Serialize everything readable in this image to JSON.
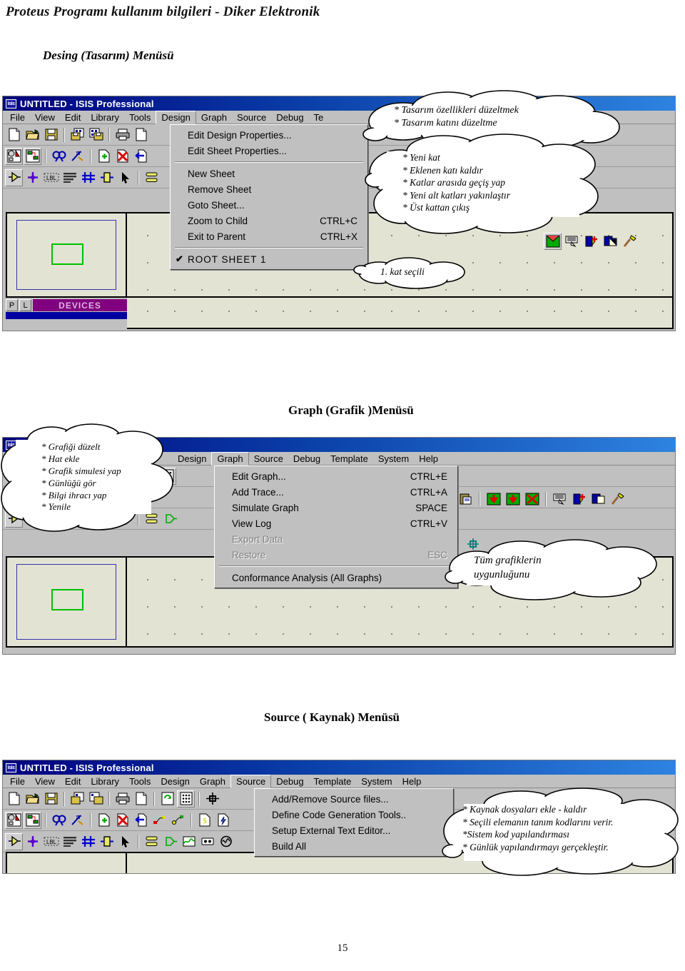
{
  "document": {
    "header": "Proteus Programı kullanım bilgileri  -  Diker  Elektronik",
    "page_number": "15"
  },
  "sections": [
    {
      "id": "design",
      "title": "Desing (Tasarım) Menüsü"
    },
    {
      "id": "graph",
      "title": "Graph (Grafik )Menüsü"
    },
    {
      "id": "source",
      "title": "Source ( Kaynak) Menüsü"
    }
  ],
  "window": {
    "title": "UNTITLED - ISIS Professional",
    "title_icon_label": "isis"
  },
  "menubar": {
    "design_window": [
      "File",
      "View",
      "Edit",
      "Library",
      "Tools",
      "Design",
      "Graph",
      "Source",
      "Debug",
      "Te"
    ],
    "graph_window": [
      "Design",
      "Graph",
      "Source",
      "Debug",
      "Template",
      "System",
      "Help"
    ],
    "source_window": [
      "File",
      "View",
      "Edit",
      "Library",
      "Tools",
      "Design",
      "Graph",
      "Source",
      "Debug",
      "Template",
      "System",
      "Help"
    ],
    "open_design": "Design",
    "open_graph": "Graph",
    "open_source": "Source"
  },
  "design_menu": {
    "items": [
      {
        "label": "Edit Design Properties...",
        "accel": ""
      },
      {
        "label": "Edit Sheet Properties...",
        "accel": ""
      },
      {
        "sep": true
      },
      {
        "label": "New Sheet",
        "accel": ""
      },
      {
        "label": "Remove Sheet",
        "accel": ""
      },
      {
        "label": "Goto Sheet...",
        "accel": ""
      },
      {
        "label": "Zoom to Child",
        "accel": "CTRL+C"
      },
      {
        "label": "Exit to Parent",
        "accel": "CTRL+X"
      },
      {
        "sep": true
      },
      {
        "label": "ROOT SHEET 1",
        "accel": "",
        "checked": true
      }
    ]
  },
  "graph_menu": {
    "items": [
      {
        "label": "Edit Graph...",
        "accel": "CTRL+E"
      },
      {
        "label": "Add Trace...",
        "accel": "CTRL+A"
      },
      {
        "label": "Simulate Graph",
        "accel": "SPACE"
      },
      {
        "label": "View Log",
        "accel": "CTRL+V"
      },
      {
        "label": "Export Data",
        "accel": "",
        "disabled": true
      },
      {
        "label": "Restore",
        "accel": "ESC",
        "disabled": true
      },
      {
        "sep": true
      },
      {
        "label": "Conformance Analysis (All Graphs)",
        "accel": ""
      }
    ]
  },
  "source_menu": {
    "items": [
      {
        "label": "Add/Remove Source files...",
        "accel": ""
      },
      {
        "label": "Define Code Generation Tools..",
        "accel": ""
      },
      {
        "label": "Setup External Text Editor...",
        "accel": ""
      },
      {
        "label": "Build All",
        "accel": ""
      }
    ]
  },
  "callouts": {
    "design_top": [
      "* Tasarım özellikleri düzeltmek",
      "* Tasarım katını düzeltme"
    ],
    "design_layers": [
      "* Yeni kat",
      "* Eklenen katı kaldır",
      "* Katlar arasıda geçiş yap",
      "* Yeni alt katları yakınlaştır",
      "* Üst kattan çıkış"
    ],
    "design_sheet": [
      "1. kat seçili"
    ],
    "graph_left": [
      "* Grafiği düzelt",
      "* Hat ekle",
      "* Grafik simulesi yap",
      "* Günlüğü gör",
      "* Bilgi ihracı yap",
      "* Yenile"
    ],
    "graph_right": [
      "Tüm            grafiklerin",
      "uygunluğunu"
    ],
    "source_right": [
      "* Kaynak dosyaları ekle - kaldır",
      "* Seçili elemanın tanım kodlarını verir.",
      "*Sistem kod yapılandırması",
      "* Günlük yapılandırmayı gerçekleştir."
    ]
  },
  "workspace": {
    "devices_label": "DEVICES",
    "p_button": "P",
    "l_button": "L"
  },
  "colors": {
    "titlebar_start": "#00007e",
    "titlebar_end": "#2e83e0",
    "chrome": "#c0c0c0",
    "canvas": "#e3e3d4",
    "devices": "#800080",
    "overview_blue": "#3333aa",
    "overview_green": "#00c000"
  }
}
